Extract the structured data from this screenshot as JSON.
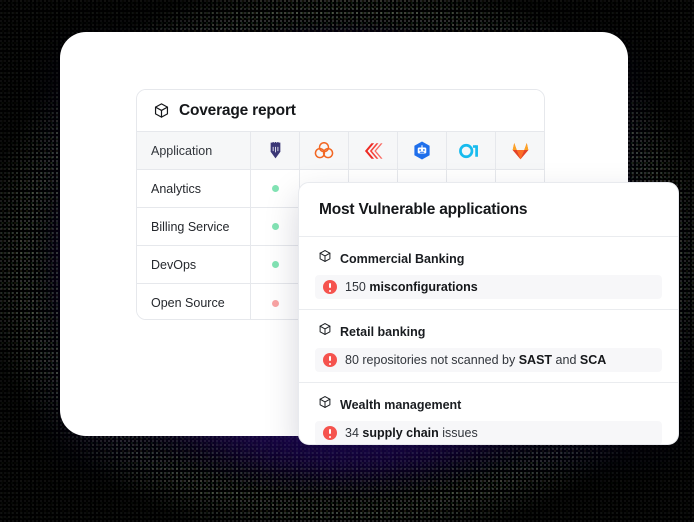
{
  "background": {
    "glow_color": "#3A1296",
    "base_color": "#000000"
  },
  "coverage_report": {
    "icon": "cube-icon",
    "title": "Coverage report",
    "columns": [
      {
        "label": "Application",
        "icon": ""
      },
      {
        "label": "",
        "icon": "vault-icon"
      },
      {
        "label": "",
        "icon": "three-circles-icon"
      },
      {
        "label": "",
        "icon": "chevrons-icon"
      },
      {
        "label": "",
        "icon": "dependabot-icon"
      },
      {
        "label": "",
        "icon": "o1-icon"
      },
      {
        "label": "",
        "icon": "gitlab-icon"
      }
    ],
    "rows": [
      {
        "application": "Analytics",
        "statuses": [
          "ok",
          "none",
          "none",
          "none",
          "none",
          "none"
        ]
      },
      {
        "application": "Billing Service",
        "statuses": [
          "ok",
          "none",
          "none",
          "none",
          "none",
          "none"
        ]
      },
      {
        "application": "DevOps",
        "statuses": [
          "ok",
          "none",
          "none",
          "none",
          "none",
          "none"
        ]
      },
      {
        "application": "Open Source",
        "statuses": [
          "bad",
          "none",
          "none",
          "none",
          "none",
          "none"
        ]
      }
    ],
    "status_colors": {
      "ok": "#82E3B4",
      "bad": "#F9A3A3"
    }
  },
  "most_vulnerable": {
    "title": "Most Vulnerable applications",
    "items": [
      {
        "app_icon": "cube-icon",
        "app_name": "Commercial Banking",
        "alert_icon": "warning-icon",
        "message_parts": [
          {
            "text": "150 ",
            "bold": false
          },
          {
            "text": "misconfigurations",
            "bold": true
          }
        ],
        "message_plain": "150 misconfigurations"
      },
      {
        "app_icon": "cube-icon",
        "app_name": "Retail banking",
        "alert_icon": "warning-icon",
        "message_parts": [
          {
            "text": "80 repositories not scanned by ",
            "bold": false
          },
          {
            "text": "SAST",
            "bold": true
          },
          {
            "text": " and ",
            "bold": false
          },
          {
            "text": "SCA",
            "bold": true
          }
        ],
        "message_plain": "80 repositories not scanned by SAST and SCA"
      },
      {
        "app_icon": "cube-icon",
        "app_name": "Wealth management",
        "alert_icon": "warning-icon",
        "message_parts": [
          {
            "text": "34 ",
            "bold": false
          },
          {
            "text": "supply chain",
            "bold": true
          },
          {
            "text": " issues",
            "bold": false
          }
        ],
        "message_plain": "34 supply chain issues"
      }
    ],
    "alert_color": "#F5534E"
  }
}
